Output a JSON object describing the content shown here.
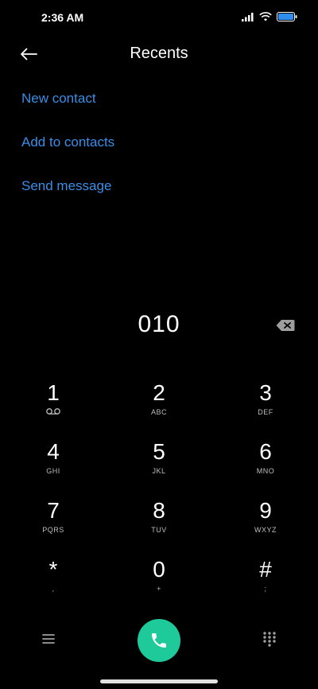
{
  "status_bar": {
    "time": "2:36 AM",
    "icons": [
      "signal-icon",
      "wifi-icon",
      "battery-icon"
    ]
  },
  "header": {
    "title": "Recents",
    "back_icon": "arrow-left-icon"
  },
  "actions": [
    {
      "label": "New contact"
    },
    {
      "label": "Add to contacts"
    },
    {
      "label": "Send message"
    }
  ],
  "dialer": {
    "number": "010",
    "backspace_icon": "backspace-icon"
  },
  "keypad": [
    {
      "digit": "1",
      "letters": ""
    },
    {
      "digit": "2",
      "letters": "ABC"
    },
    {
      "digit": "3",
      "letters": "DEF"
    },
    {
      "digit": "4",
      "letters": "GHI"
    },
    {
      "digit": "5",
      "letters": "JKL"
    },
    {
      "digit": "6",
      "letters": "MNO"
    },
    {
      "digit": "7",
      "letters": "PQRS"
    },
    {
      "digit": "8",
      "letters": "TUV"
    },
    {
      "digit": "9",
      "letters": "WXYZ"
    },
    {
      "digit": "*",
      "letters": ","
    },
    {
      "digit": "0",
      "letters": "+"
    },
    {
      "digit": "#",
      "letters": ";"
    }
  ],
  "bottom_bar": {
    "icons": [
      "menu-icon",
      "phone-icon",
      "dialpad-icon"
    ]
  },
  "colors": {
    "accent": "#3a8ee6",
    "call_button": "#1ec99a",
    "background": "#000000"
  }
}
